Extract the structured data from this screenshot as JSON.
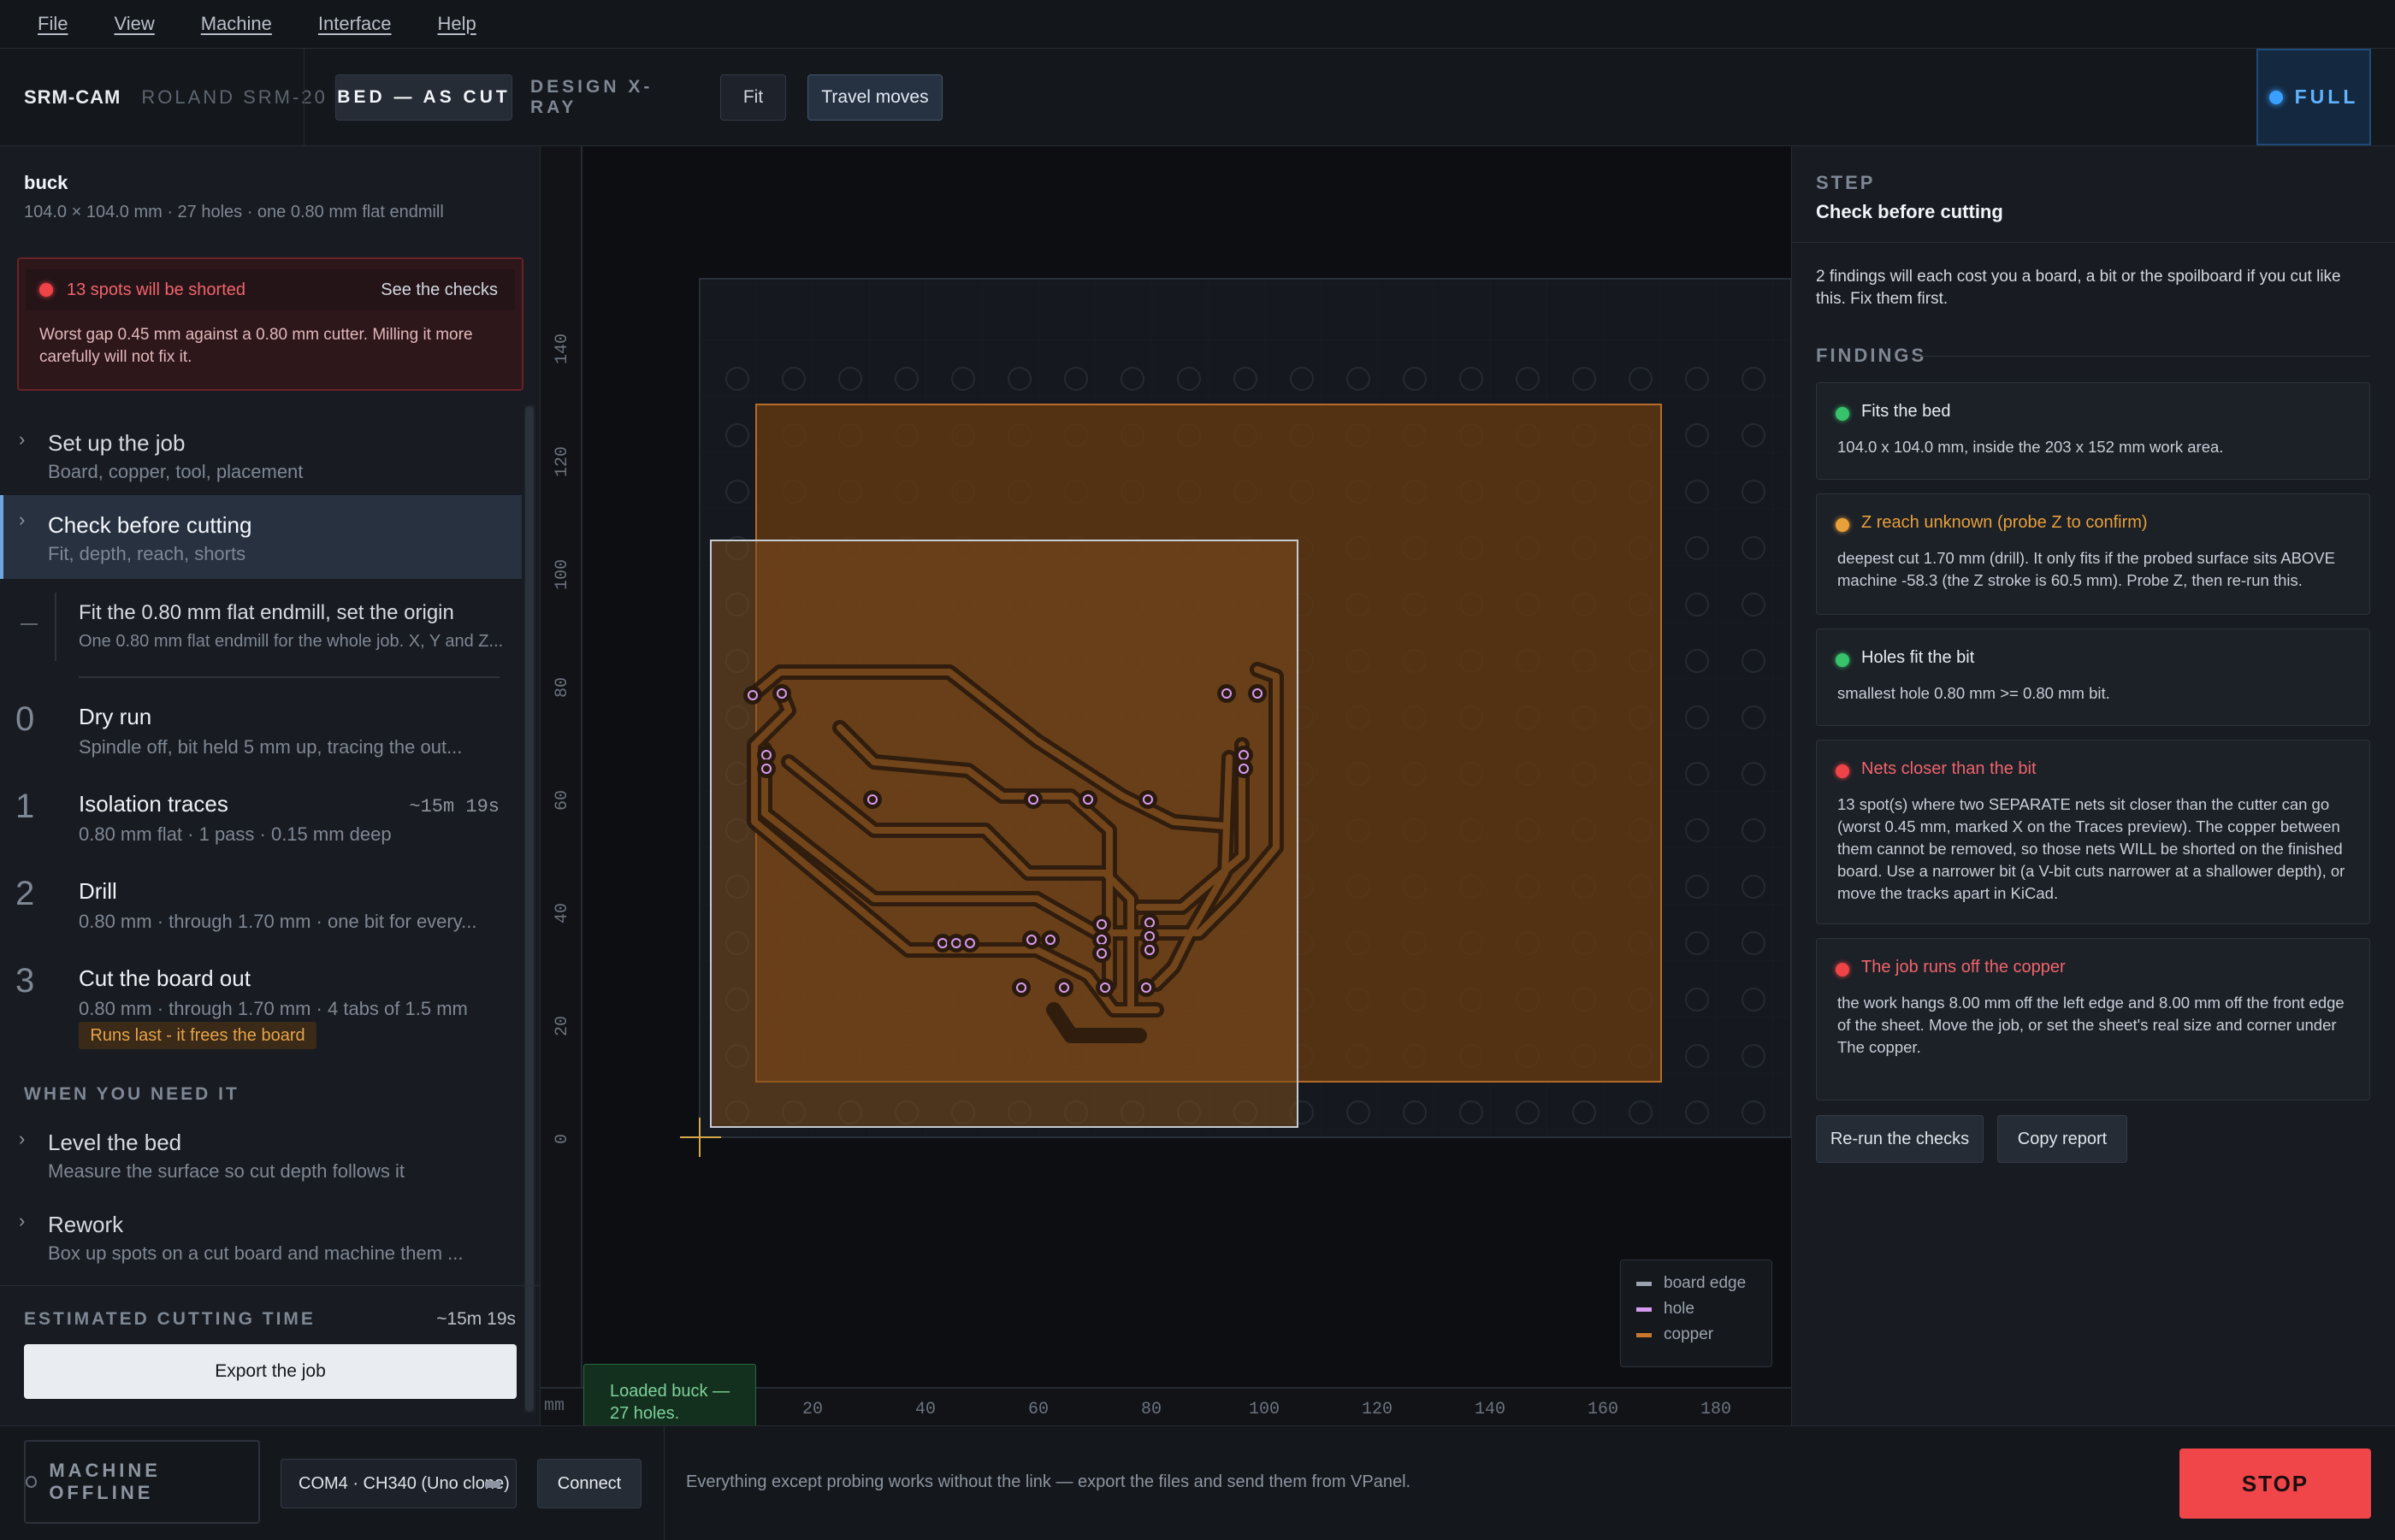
{
  "menu": [
    "File",
    "View",
    "Machine",
    "Interface",
    "Help"
  ],
  "toolbar": {
    "app": "SRM-CAM",
    "machine": "ROLAND SRM-20",
    "tab_bed": "BED — AS CUT",
    "tab_xray": "DESIGN X-RAY",
    "fit": "Fit",
    "travel": "Travel moves",
    "full": "FULL"
  },
  "job": {
    "name": "buck",
    "summary": "104.0 × 104.0 mm · 27 holes · one 0.80 mm flat endmill"
  },
  "alert": {
    "title": "13 spots will be shorted",
    "link": "See the checks",
    "body": "Worst gap 0.45 mm against a 0.80 mm cutter. Milling it more carefully will not fix it."
  },
  "steps": {
    "setup": {
      "title": "Set up the job",
      "sub": "Board, copper, tool, placement"
    },
    "check": {
      "title": "Check before cutting",
      "sub": "Fit, depth, reach, shorts"
    },
    "fit": {
      "title": "Fit the 0.80 mm flat endmill, set the origin",
      "sub": "One 0.80 mm flat endmill for the whole job. X, Y and Z..."
    },
    "ops": [
      {
        "num": "0",
        "title": "Dry run",
        "sub": "Spindle off, bit held 5 mm up, tracing the out...",
        "dur": ""
      },
      {
        "num": "1",
        "title": "Isolation traces",
        "sub": "0.80 mm flat · 1 pass · 0.15 mm deep",
        "dur": "~15m 19s"
      },
      {
        "num": "2",
        "title": "Drill",
        "sub": "0.80 mm · through 1.70 mm · one bit for every...",
        "dur": ""
      },
      {
        "num": "3",
        "title": "Cut the board out",
        "sub": "0.80 mm · through 1.70 mm · 4 tabs of 1.5 mm",
        "dur": ""
      }
    ],
    "badge": "Runs last - it frees the board",
    "when_head": "WHEN YOU NEED IT",
    "level": {
      "title": "Level the bed",
      "sub": "Measure the surface so cut depth follows it"
    },
    "rework": {
      "title": "Rework",
      "sub": "Box up spots on a cut board and machine them ..."
    }
  },
  "estimate": {
    "label": "ESTIMATED CUTTING TIME",
    "value": "~15m 19s",
    "export": "Export the job"
  },
  "canvas": {
    "x_ticks": [
      "20",
      "40",
      "60",
      "80",
      "100",
      "120",
      "140",
      "160",
      "180"
    ],
    "y_ticks": [
      "140",
      "120",
      "100",
      "80",
      "60",
      "40",
      "20",
      "0"
    ],
    "unit": "mm",
    "legend": [
      "board edge",
      "hole",
      "copper"
    ],
    "toast": "Loaded buck — 27 holes.",
    "colors": {
      "board_edge": "#9aa3ae",
      "hole": "#d79cf0",
      "copper": "#c8782a"
    }
  },
  "right": {
    "label": "STEP",
    "title": "Check before cutting",
    "intro": "2 findings will each cost you a board, a bit or the spoilboard if you cut like this. Fix them first.",
    "findings_head": "FINDINGS",
    "findings": [
      {
        "status": "ok",
        "color": "#37c36b",
        "title": "Fits the bed",
        "body": "104.0 x 104.0 mm, inside the 203 x 152 mm work area."
      },
      {
        "status": "warn",
        "color": "#e8a03a",
        "title": "Z reach unknown (probe Z to confirm)",
        "body": "deepest cut 1.70 mm (drill). It only fits if the probed surface sits ABOVE machine -58.3 (the Z stroke is 60.5 mm). Probe Z, then re-run this."
      },
      {
        "status": "ok",
        "color": "#37c36b",
        "title": "Holes fit the bit",
        "body": "smallest hole 0.80 mm >= 0.80 mm bit."
      },
      {
        "status": "error",
        "color": "#ef4348",
        "title": "Nets closer than the bit",
        "body": "13 spot(s) where two SEPARATE nets sit closer than the cutter can go (worst 0.45 mm, marked X on the Traces preview). The copper between them cannot be removed, so those nets WILL be shorted on the finished board. Use a narrower bit (a V-bit cuts narrower at a shallower depth), or move the tracks apart in KiCad."
      },
      {
        "status": "error",
        "color": "#ef4348",
        "title": "The job runs off the copper",
        "body": "the work hangs 8.00 mm off the left edge and 8.00 mm off the front edge of the sheet. Move the job, or set the sheet's real size and corner under The copper."
      }
    ],
    "rerun": "Re-run the checks",
    "copy": "Copy report"
  },
  "bottom": {
    "offline": "MACHINE OFFLINE",
    "port": "COM4 · CH340 (Uno clone)",
    "connect": "Connect",
    "hint": "Everything except probing works without the link — export the files and send them from VPanel.",
    "stop": "STOP"
  }
}
